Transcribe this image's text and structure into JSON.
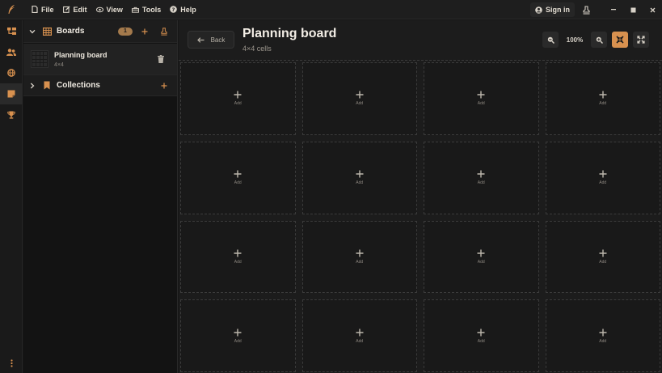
{
  "menubar": {
    "items": [
      {
        "label": "File",
        "icon": "file-icon"
      },
      {
        "label": "Edit",
        "icon": "edit-icon"
      },
      {
        "label": "View",
        "icon": "eye-icon"
      },
      {
        "label": "Tools",
        "icon": "toolbox-icon"
      },
      {
        "label": "Help",
        "icon": "help-icon"
      }
    ],
    "sign_in": "Sign in"
  },
  "colors": {
    "accent": "#d8914f",
    "badge": "#a47a4c"
  },
  "sidebar": {
    "boards": {
      "title": "Boards",
      "count": "1",
      "items": [
        {
          "name": "Planning board",
          "size": "4×4"
        }
      ]
    },
    "collections": {
      "title": "Collections"
    }
  },
  "main": {
    "back_label": "Back",
    "title": "Planning board",
    "subtitle": "4×4 cells",
    "zoom": "100%",
    "cell_add_label": "Add"
  }
}
